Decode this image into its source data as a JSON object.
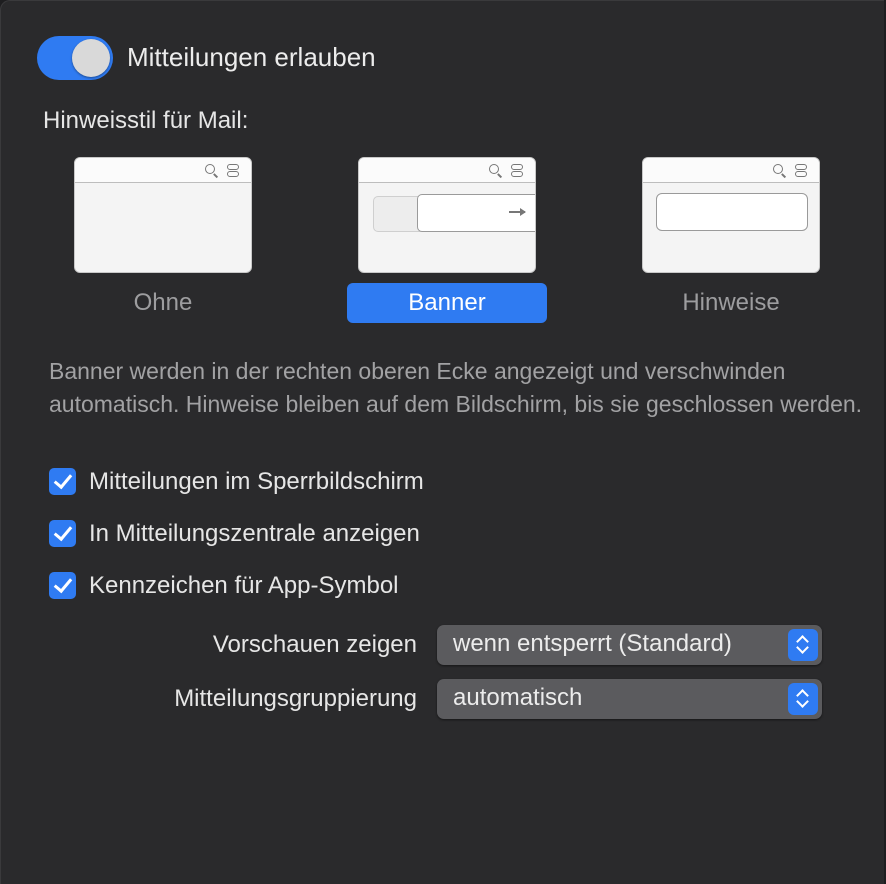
{
  "notifications": {
    "allow_label": "Mitteilungen erlauben",
    "allow_enabled": true
  },
  "alert_style": {
    "heading": "Hinweisstil für Mail:",
    "options": [
      {
        "label": "Ohne",
        "selected": false
      },
      {
        "label": "Banner",
        "selected": true
      },
      {
        "label": "Hinweise",
        "selected": false
      }
    ],
    "description": "Banner werden in der rechten oberen Ecke angezeigt und verschwinden automatisch. Hinweise bleiben auf dem Bildschirm, bis sie geschlossen werden."
  },
  "checkboxes": [
    {
      "label": "Mitteilungen im Sperrbildschirm",
      "checked": true
    },
    {
      "label": "In Mitteilungszentrale anzeigen",
      "checked": true
    },
    {
      "label": "Kennzeichen für App-Symbol",
      "checked": true
    }
  ],
  "selects": {
    "previews": {
      "label": "Vorschauen zeigen",
      "value": "wenn entsperrt (Standard)"
    },
    "grouping": {
      "label": "Mitteilungsgruppierung",
      "value": "automatisch"
    }
  },
  "colors": {
    "accent": "#2f7bf2",
    "panel_background": "#2a2a2c",
    "secondary_text": "#a2a2a4"
  }
}
